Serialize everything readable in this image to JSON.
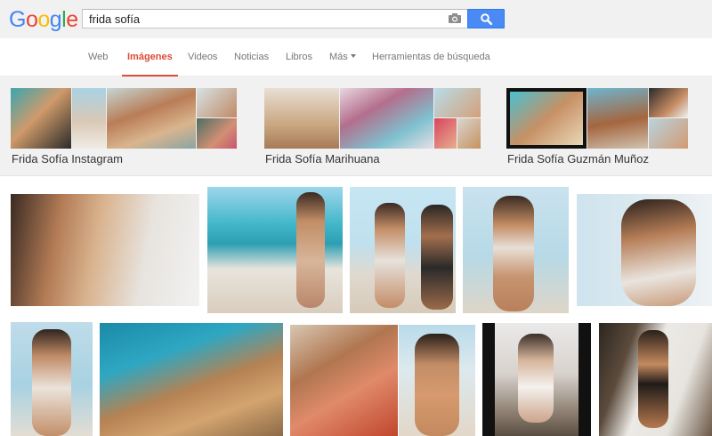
{
  "logo": {
    "letters": [
      "G",
      "o",
      "o",
      "g",
      "l",
      "e"
    ],
    "colors": [
      "#4285f4",
      "#ea4335",
      "#fbbc05",
      "#4285f4",
      "#34a853",
      "#ea4335"
    ]
  },
  "search": {
    "query": "frida sofía",
    "placeholder": ""
  },
  "icons": {
    "camera": "camera-icon",
    "search": "magnifier-icon",
    "more": "caret-down-icon"
  },
  "colors": {
    "accent": "#dd4b39",
    "search_button": "#4a8af4"
  },
  "tabs": [
    {
      "label": "Web",
      "active": false
    },
    {
      "label": "Imágenes",
      "active": true
    },
    {
      "label": "Videos",
      "active": false
    },
    {
      "label": "Noticias",
      "active": false
    },
    {
      "label": "Libros",
      "active": false
    },
    {
      "label": "Más",
      "active": false,
      "dropdown": true
    },
    {
      "label": "Herramientas de búsqueda",
      "active": false
    }
  ],
  "related": [
    {
      "label": "Frida Sofía Instagram"
    },
    {
      "label": "Frida Sofía Marihuana"
    },
    {
      "label": "Frida Sofía Guzmán Muñoz"
    }
  ]
}
